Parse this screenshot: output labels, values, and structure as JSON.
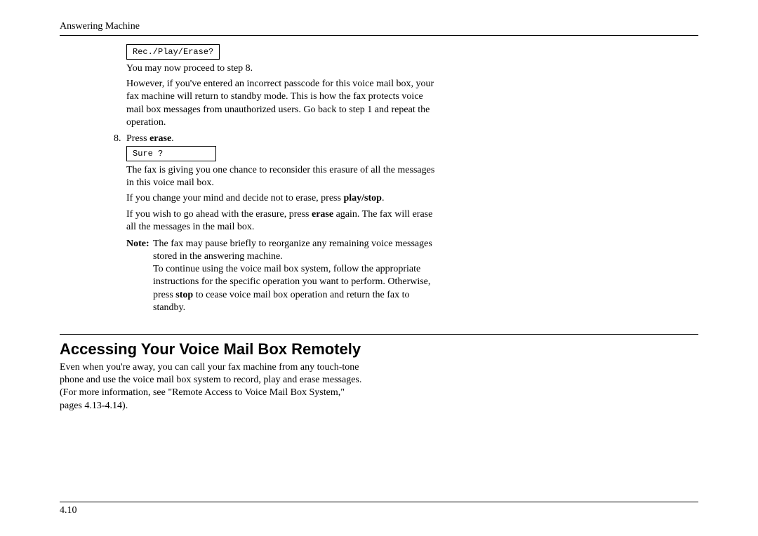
{
  "header": "Answering Machine",
  "display1": "Rec./Play/Erase?",
  "p1": "You may now proceed to step 8.",
  "p2": "However, if you've entered an incorrect passcode for this voice mail box, your fax machine will return to standby mode. This is how the fax protects voice mail box messages from unauthorized users. Go back to step 1 and repeat the operation.",
  "step8_num": "8.",
  "step8_a": "Press ",
  "step8_b": "erase",
  "step8_c": ".",
  "display2": "Sure ?",
  "p3": "The fax is giving you one chance to reconsider this erasure of all the messages in this voice mail box.",
  "p4_a": "If you change your mind and decide not to erase, press ",
  "p4_b": "play/stop",
  "p4_c": ".",
  "p5_a": "If you wish to go ahead with the erasure, press ",
  "p5_b": "erase",
  "p5_c": " again. The fax will erase all the messages in the mail box.",
  "note_label": "Note:",
  "note_a": "The fax may pause briefly to reorganize any remaining voice messages stored in the answering machine.",
  "note_b1": "To continue using the voice mail box system, follow the appropriate instructions for the specific operation you want to perform. Otherwise, press ",
  "note_b2": "stop",
  "note_b3": " to cease voice mail box operation and return the fax to standby.",
  "heading": "Accessing Your Voice Mail Box Remotely",
  "intro": "Even when you're away, you can call your fax machine from any touch-tone phone and use the voice mail box system to record, play and erase messages. (For more information, see \"Remote Access to Voice Mail Box System,\" pages 4.13-4.14).",
  "footer": "4.10"
}
